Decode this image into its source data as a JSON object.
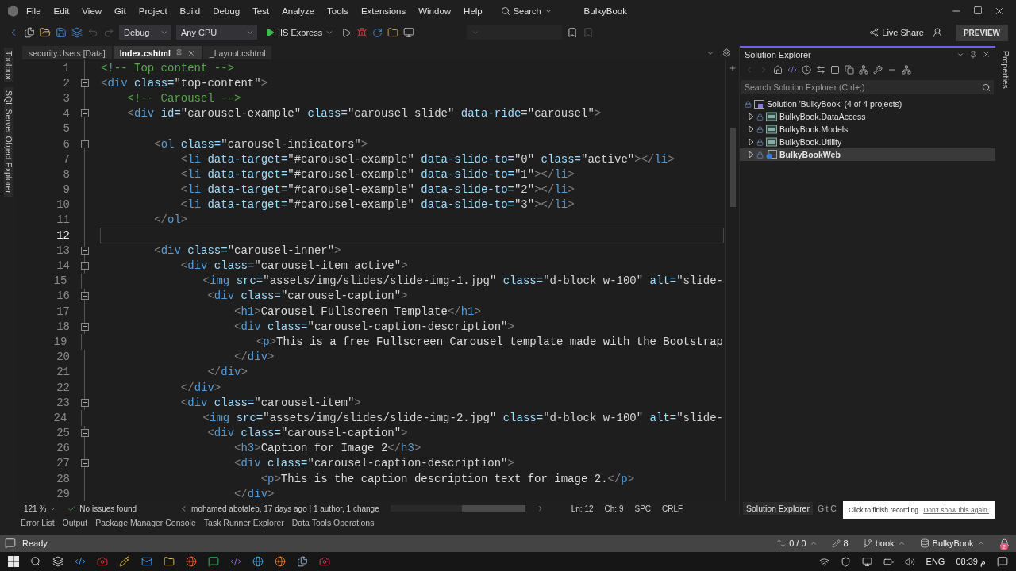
{
  "menu_bar": {
    "items": [
      "File",
      "Edit",
      "View",
      "Git",
      "Project",
      "Build",
      "Debug",
      "Test",
      "Analyze",
      "Tools",
      "Extensions",
      "Window",
      "Help"
    ],
    "search": "Search",
    "solution_name": "BulkyBook"
  },
  "toolbar": {
    "configuration": "Debug",
    "platform": "Any CPU",
    "run_target": "IIS Express",
    "live_share": "Live Share",
    "preview": "PREVIEW"
  },
  "side_strip_left": [
    "Toolbox",
    "SQL Server Object Explorer"
  ],
  "side_strip_right": [
    "Properties"
  ],
  "editor": {
    "tabs": [
      {
        "label": "security.Users [Data]",
        "selected": false
      },
      {
        "label": "Index.cshtml",
        "selected": true
      },
      {
        "label": "_Layout.cshtml",
        "selected": false
      }
    ],
    "lines": [
      {
        "number": "1",
        "code": "<!-- Top content -->",
        "foldable": false,
        "current": false
      },
      {
        "number": "2",
        "code": "<div class=\"top-content\">",
        "foldable": true,
        "current": false
      },
      {
        "number": "3",
        "code": "    <!-- Carousel -->",
        "foldable": false,
        "current": false
      },
      {
        "number": "4",
        "code": "    <div id=\"carousel-example\" class=\"carousel slide\" data-ride=\"carousel\">",
        "foldable": true,
        "current": false
      },
      {
        "number": "5",
        "foldable": false,
        "current": false
      },
      {
        "number": "6",
        "code": "        <ol class=\"carousel-indicators\">",
        "foldable": true,
        "current": false
      },
      {
        "number": "7",
        "code": "            <li data-target=\"#carousel-example\" data-slide-to=\"0\" class=\"active\"></li>",
        "foldable": false,
        "current": false
      },
      {
        "number": "8",
        "code": "            <li data-target=\"#carousel-example\" data-slide-to=\"1\"></li>",
        "foldable": false,
        "current": false
      },
      {
        "number": "9",
        "code": "            <li data-target=\"#carousel-example\" data-slide-to=\"2\"></li>",
        "foldable": false,
        "current": false
      },
      {
        "number": "10",
        "code": "            <li data-target=\"#carousel-example\" data-slide-to=\"3\"></li>",
        "foldable": false,
        "current": false
      },
      {
        "number": "11",
        "code": "        </ol>",
        "foldable": false,
        "current": false
      },
      {
        "number": "12",
        "foldable": false,
        "current": true
      },
      {
        "number": "13",
        "code": "        <div class=\"carousel-inner\">",
        "foldable": true,
        "current": false
      },
      {
        "number": "14",
        "code": "            <div class=\"carousel-item active\">",
        "foldable": true,
        "current": false
      },
      {
        "number": "15",
        "code": "                <img src=\"assets/img/slides/slide-img-1.jpg\" class=\"d-block w-100\" alt=\"slide-",
        "foldable": false,
        "current": false
      },
      {
        "number": "16",
        "code": "                <div class=\"carousel-caption\">",
        "foldable": true,
        "current": false
      },
      {
        "number": "17",
        "code": "                    <h1>Carousel Fullscreen Template</h1>",
        "foldable": false,
        "current": false
      },
      {
        "number": "18",
        "code": "                    <div class=\"carousel-caption-description\">",
        "foldable": true,
        "current": false
      },
      {
        "number": "19",
        "code": "                        <p>This is a free Fullscreen Carousel template made with the Bootstrap",
        "foldable": false,
        "current": false
      },
      {
        "number": "20",
        "code": "                    </div>",
        "foldable": false,
        "current": false
      },
      {
        "number": "21",
        "code": "                </div>",
        "foldable": false,
        "current": false
      },
      {
        "number": "22",
        "code": "            </div>",
        "foldable": false,
        "current": false
      },
      {
        "number": "23",
        "code": "            <div class=\"carousel-item\">",
        "foldable": true,
        "current": false
      },
      {
        "number": "24",
        "code": "                <img src=\"assets/img/slides/slide-img-2.jpg\" class=\"d-block w-100\" alt=\"slide-",
        "foldable": false,
        "current": false
      },
      {
        "number": "25",
        "code": "                <div class=\"carousel-caption\">",
        "foldable": true,
        "current": false
      },
      {
        "number": "26",
        "code": "                    <h3>Caption for Image 2</h3>",
        "foldable": false,
        "current": false
      },
      {
        "number": "27",
        "code": "                    <div class=\"carousel-caption-description\">",
        "foldable": true,
        "current": false
      },
      {
        "number": "28",
        "code": "                        <p>This is the caption description text for image 2.</p>",
        "foldable": false,
        "current": false
      },
      {
        "number": "29",
        "code": "                    </div>",
        "foldable": false,
        "current": false
      }
    ],
    "status": {
      "zoom": "121 %",
      "issues": "No issues found",
      "blame": "mohamed abotaleb, 17 days ago | 1 author, 1 change",
      "line": "Ln: 12",
      "column": "Ch: 9",
      "whitespace": "SPC",
      "line_ending": "CRLF"
    }
  },
  "solution_explorer": {
    "title": "Solution Explorer",
    "search": {
      "placeholder": "Search Solution Explorer (Ctrl+;)"
    },
    "tree": {
      "label": "Solution 'BulkyBook' (4 of 4 projects)",
      "children": [
        {
          "label": "BulkyBook.DataAccess",
          "kind": "library",
          "expanded": false,
          "selected": false,
          "startup": false
        },
        {
          "label": "BulkyBook.Models",
          "kind": "library",
          "expanded": false,
          "selected": false,
          "startup": false
        },
        {
          "label": "BulkyBook.Utility",
          "kind": "library",
          "expanded": false,
          "selected": false,
          "startup": false
        },
        {
          "label": "BulkyBookWeb",
          "kind": "web",
          "expanded": false,
          "selected": true,
          "startup": true
        }
      ]
    },
    "tabs": [
      {
        "label": "Solution Explorer",
        "selected": true
      },
      {
        "label": "Git C",
        "selected": false
      }
    ]
  },
  "recording_tip": {
    "message": "Click to finish recording.",
    "link": "Don't show this again."
  },
  "tool_tabs": [
    "Error List",
    "Output",
    "Package Manager Console",
    "Task Runner Explorer",
    "Data Tools Operations"
  ],
  "status_bar": {
    "message": "Ready",
    "changes": "0 / 0",
    "edits": "8",
    "branch": "book",
    "repository": "BulkyBook",
    "notifications": "2"
  },
  "taskbar": {
    "language": "ENG",
    "time": "08:39 م"
  }
}
